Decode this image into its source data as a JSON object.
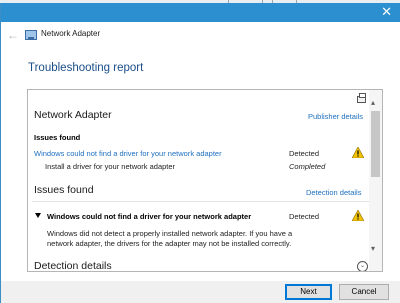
{
  "window": {
    "title": "Network Adapter",
    "close_glyph": "✕",
    "back_glyph": "←"
  },
  "page": {
    "heading": "Troubleshooting report"
  },
  "report": {
    "section1": {
      "title": "Network Adapter",
      "link": "Publisher details",
      "subheading": "Issues found",
      "issue_link": "Windows could not find a driver for your network adapter",
      "issue_status": "Detected",
      "fix_text": "Install a driver for your network adapter",
      "fix_status": "Completed"
    },
    "section2": {
      "title": "Issues found",
      "link": "Detection details",
      "issue_title": "Windows could not find a driver for your network adapter",
      "issue_status": "Detected",
      "description_line1": "Windows did not detect a properly installed network adapter. If you have a",
      "description_line2": "network adapter, the drivers for the adapter may not be installed correctly."
    },
    "section3": {
      "title": "Detection details"
    },
    "icons": {
      "print": "printer-icon",
      "warning": "warning-icon",
      "expand": "chevron-down-icon"
    }
  },
  "buttons": {
    "next": "Next",
    "cancel": "Cancel"
  },
  "colors": {
    "titlebar": "#2c8fd0",
    "heading": "#1c4f8a",
    "link": "#1e6fbf",
    "warning": "#f2c200"
  }
}
